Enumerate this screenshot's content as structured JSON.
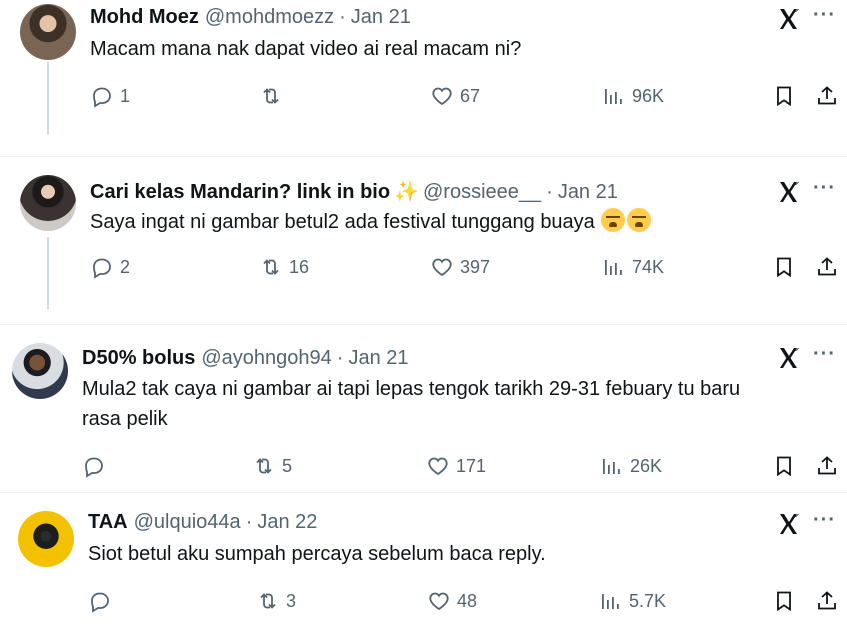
{
  "tweets": [
    {
      "name": "Mohd Moez",
      "handle": "@mohdmoezz",
      "date": "Jan 21",
      "text": "Macam mana nak dapat video ai real macam ni?",
      "replies": "1",
      "retweets": "",
      "likes": "67",
      "views": "96K"
    },
    {
      "name": "Cari kelas Mandarin? link in bio",
      "handle": "@rossieee__",
      "date": "Jan 21",
      "text": "Saya ingat ni gambar betul2 ada festival tunggang buaya",
      "replies": "2",
      "retweets": "16",
      "likes": "397",
      "views": "74K"
    },
    {
      "name": "D50% bolus",
      "handle": "@ayohngoh94",
      "date": "Jan 21",
      "text_line1": "Mula2 tak caya ni gambar ai tapi lepas tengok tarikh 29-31 febuary tu baru",
      "text_line2": "rasa pelik",
      "replies": "",
      "retweets": "5",
      "likes": "171",
      "views": "26K"
    },
    {
      "name": "TAA",
      "handle": "@ulquio44a",
      "date": "Jan 22",
      "text": "Siot betul aku sumpah percaya sebelum baca reply.",
      "replies": "",
      "retweets": "3",
      "likes": "48",
      "views": "5.7K"
    }
  ],
  "separator": "·",
  "more_label": "···",
  "icons": [
    "reply-icon",
    "retweet-icon",
    "like-icon",
    "views-icon",
    "bookmark-icon",
    "share-icon",
    "grok-icon",
    "sparkles-emoji",
    "crying-emoji"
  ],
  "colors": {
    "text": "#0f1419",
    "muted": "#536471",
    "divider": "#eff3f4"
  }
}
